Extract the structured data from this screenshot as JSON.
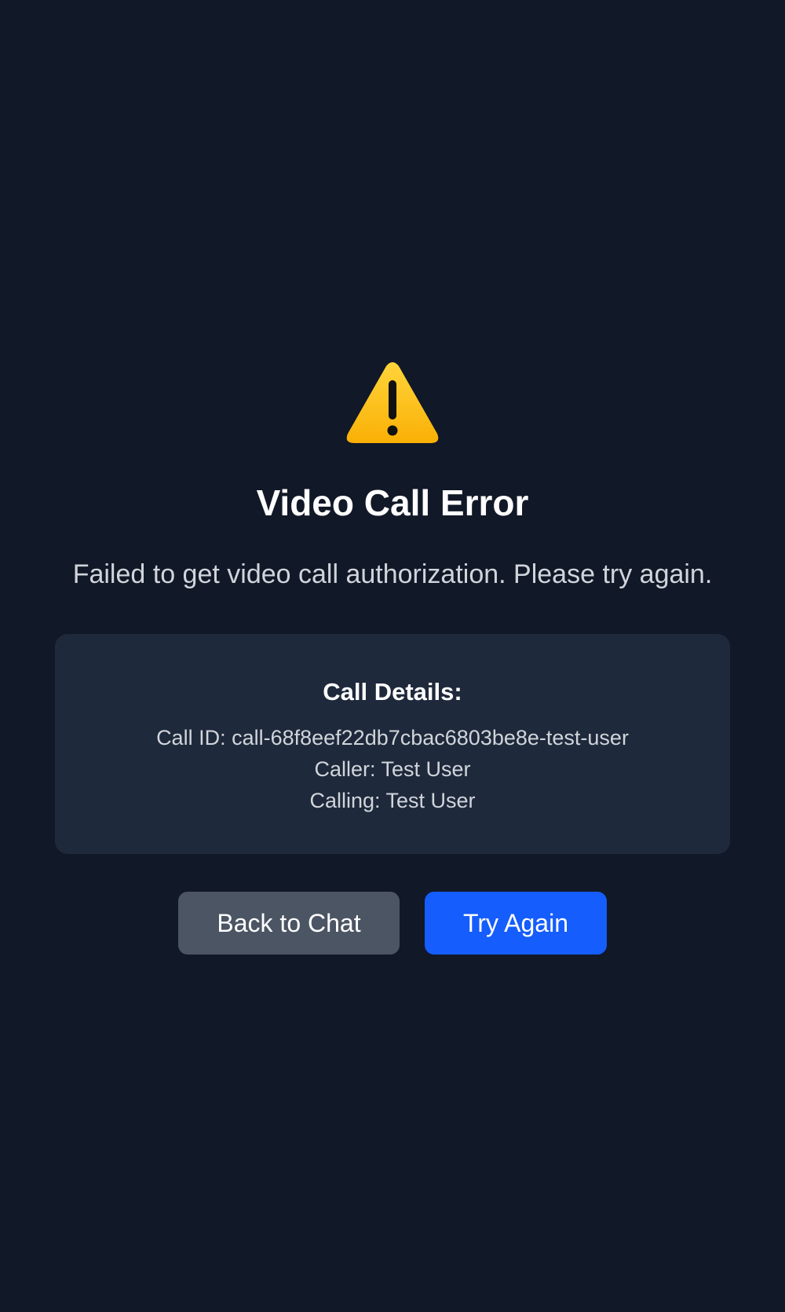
{
  "icons": {
    "warning": "warning-triangle-icon"
  },
  "colors": {
    "background": "#111827",
    "card": "#1e293b",
    "back_button": "#4b5563",
    "retry_button": "#155dfc",
    "warning": "#fcc419"
  },
  "error": {
    "title": "Video Call Error",
    "message": "Failed to get video call authorization. Please try again."
  },
  "details": {
    "heading": "Call Details:",
    "call_id": "Call ID: call-68f8eef22db7cbac6803be8e-test-user",
    "caller": "Caller: Test User",
    "calling": "Calling: Test User"
  },
  "actions": {
    "back_label": "Back to Chat",
    "retry_label": "Try Again"
  }
}
